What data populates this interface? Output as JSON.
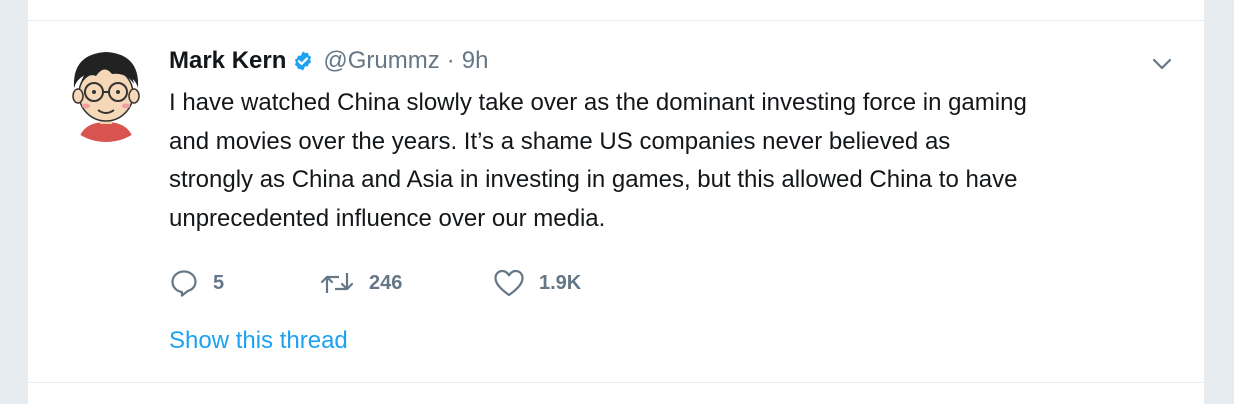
{
  "tweet": {
    "author_name": "Mark Kern",
    "handle": "@Grummz",
    "separator": "·",
    "timestamp": "9h",
    "verified": true,
    "text_lines": [
      "I have watched China slowly take over as the dominant investing force in gaming",
      "and movies over the years. It’s a shame US companies never believed as",
      "strongly as China and Asia in investing in games, but this allowed China to have",
      "unprecedented influence over our media."
    ],
    "actions": {
      "replies": "5",
      "retweets": "246",
      "likes": "1.9K"
    },
    "thread_link": "Show this thread"
  },
  "icons": {
    "verified": "verified-badge-icon",
    "caret": "chevron-down-icon",
    "reply": "reply-bubble-icon",
    "retweet": "retweet-icon",
    "like": "heart-icon"
  },
  "colors": {
    "accent": "#1da1f2",
    "text": "#14171a",
    "secondary": "#657786",
    "background": "#e6ecf0",
    "card": "#ffffff"
  }
}
